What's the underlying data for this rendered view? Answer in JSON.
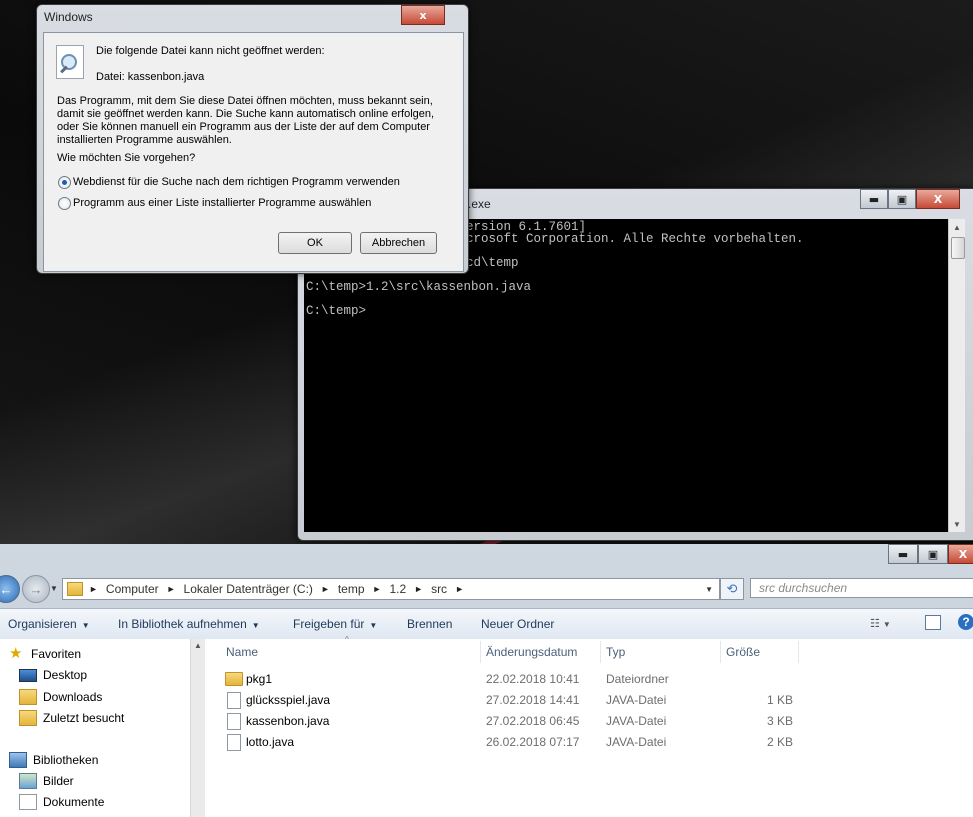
{
  "dialog": {
    "title": "Windows",
    "close_glyph": "x",
    "heading": "Die folgende Datei kann nicht geöffnet werden:",
    "file_line": "Datei:  kassenbon.java",
    "paragraph": [
      "Das Programm, mit dem Sie diese Datei öffnen möchten, muss bekannt sein,",
      "damit sie geöffnet werden kann. Die Suche kann automatisch online erfolgen,",
      "oder Sie können manuell ein Programm aus der Liste der auf dem Computer",
      "installierten Programme auswählen."
    ],
    "question": "Wie möchten Sie vorgehen?",
    "options": [
      {
        "label": "Webdienst für die Suche nach dem richtigen Programm verwenden",
        "selected": true
      },
      {
        "label": "Programm aus einer Liste installierter Programme auswählen",
        "selected": false
      }
    ],
    "ok_label": "OK",
    "cancel_label": "Abbrechen"
  },
  "console": {
    "title": ".exe",
    "lines": [
      "ersion 6.1.7601]",
      "crosoft Corporation. Alle Rechte vorbehalten.",
      "cd\\temp",
      "C:\\temp>1.2\\src\\kassenbon.java",
      "C:\\temp>"
    ],
    "min_glyph": "▬",
    "max_glyph": "▣",
    "close_glyph": "X"
  },
  "explorer": {
    "breadcrumb": [
      "Computer",
      "Lokaler Datenträger (C:)",
      "temp",
      "1.2",
      "src"
    ],
    "search_placeholder": "src durchsuchen",
    "toolbar": [
      "Organisieren",
      "In Bibliothek aufnehmen",
      "Freigeben für",
      "Brennen",
      "Neuer Ordner"
    ],
    "nav": {
      "favorites": "Favoriten",
      "desktop": "Desktop",
      "downloads": "Downloads",
      "recent": "Zuletzt besucht",
      "libraries": "Bibliotheken",
      "pictures": "Bilder",
      "documents": "Dokumente"
    },
    "columns": {
      "name": "Name",
      "date": "Änderungsdatum",
      "type": "Typ",
      "size": "Größe"
    },
    "files": [
      {
        "name": "pkg1",
        "date": "22.02.2018 10:41",
        "type": "Dateiordner",
        "size": "",
        "icon": "folder-icon"
      },
      {
        "name": "glücksspiel.java",
        "date": "27.02.2018 14:41",
        "type": "JAVA-Datei",
        "size": "1 KB",
        "icon": "file-icon"
      },
      {
        "name": "kassenbon.java",
        "date": "27.02.2018 06:45",
        "type": "JAVA-Datei",
        "size": "3 KB",
        "icon": "file-icon"
      },
      {
        "name": "lotto.java",
        "date": "26.02.2018 07:17",
        "type": "JAVA-Datei",
        "size": "2 KB",
        "icon": "file-icon"
      }
    ]
  }
}
